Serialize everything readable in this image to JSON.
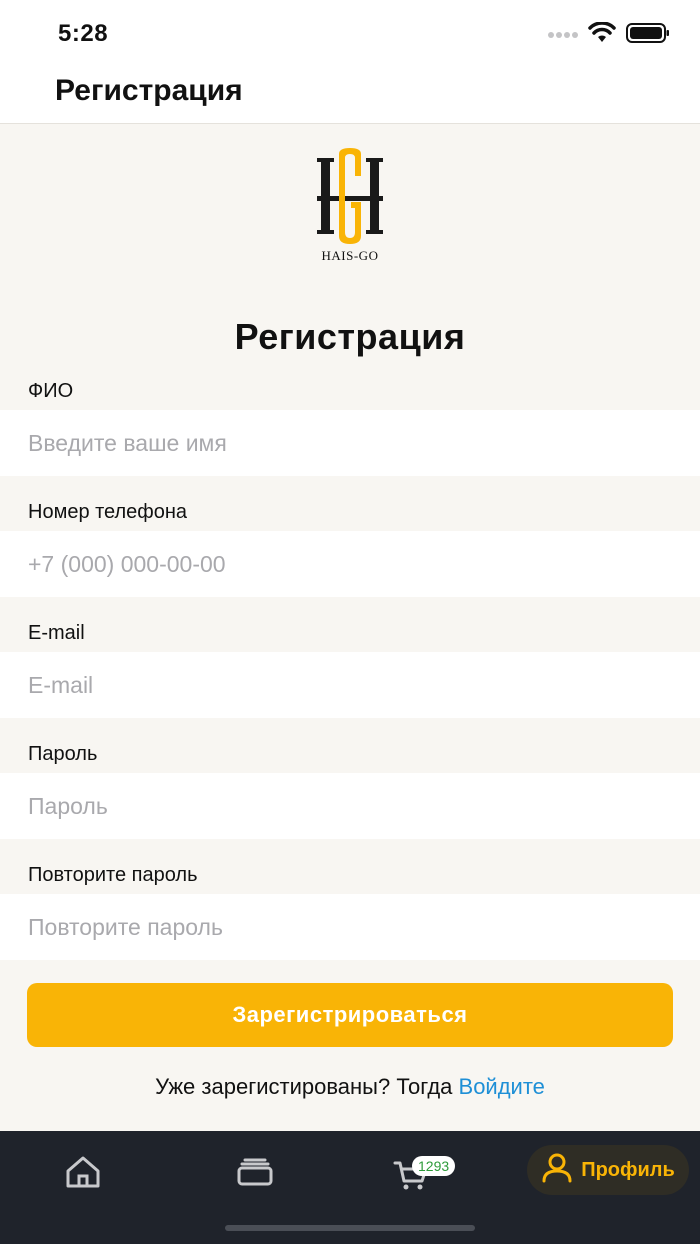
{
  "status_bar": {
    "time": "5:28"
  },
  "header": {
    "title": "Регистрация"
  },
  "logo": {
    "text": "HAIS-GO"
  },
  "form": {
    "title": "Регистрация",
    "fields": [
      {
        "label": "ФИО",
        "placeholder": "Введите ваше имя",
        "value": ""
      },
      {
        "label": "Номер телефона",
        "placeholder": "+7 (000) 000-00-00",
        "value": ""
      },
      {
        "label": "E-mail",
        "placeholder": "E-mail",
        "value": ""
      },
      {
        "label": "Пароль",
        "placeholder": "Пароль",
        "value": ""
      },
      {
        "label": "Повторите пароль",
        "placeholder": "Повторите пароль",
        "value": ""
      }
    ],
    "submit_label": "Зарегистрироваться",
    "login_prompt": "Уже зарегистированы? Тогда ",
    "login_link": "Войдите"
  },
  "tab_bar": {
    "items": [
      {
        "icon": "home-icon"
      },
      {
        "icon": "catalog-icon"
      },
      {
        "icon": "cart-icon",
        "badge": "1293"
      },
      {
        "icon": "profile-icon",
        "label": "Профиль",
        "active": true
      }
    ]
  },
  "colors": {
    "accent": "#f9b406",
    "link": "#1e8fd6",
    "tab_bar_bg": "#1f232b",
    "page_bg": "#f8f6f2"
  }
}
